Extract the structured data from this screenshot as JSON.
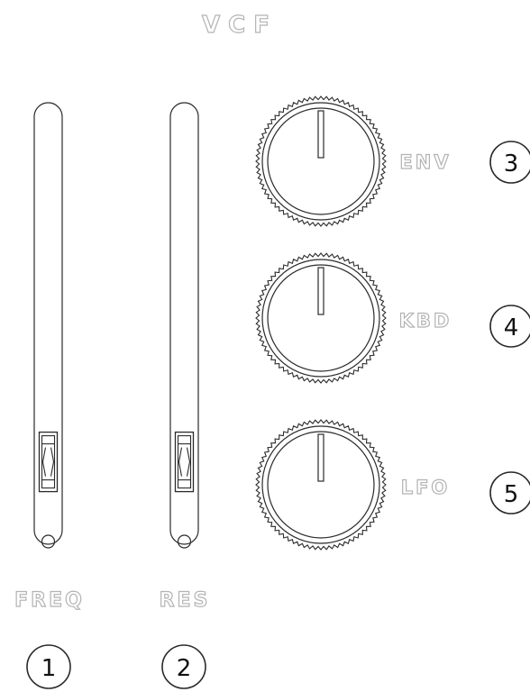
{
  "panel": {
    "title": "VCF"
  },
  "faders": [
    {
      "label": "FREQ",
      "number": "1",
      "level": 0.1
    },
    {
      "label": "RES",
      "number": "2",
      "level": 0.1
    }
  ],
  "knobs": [
    {
      "label": "ENV",
      "number": "3",
      "value": 0.5
    },
    {
      "label": "KBD",
      "number": "4",
      "value": 0.5
    },
    {
      "label": "LFO",
      "number": "5",
      "value": 0.5
    }
  ],
  "colors": {
    "line": "#2a2a2a",
    "label_outline": "#b3b3b3",
    "background": "#ffffff"
  }
}
